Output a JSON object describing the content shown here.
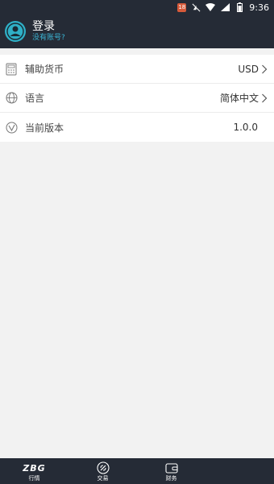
{
  "status_bar": {
    "time": "9:36",
    "notification_badge": "18"
  },
  "header": {
    "title": "登录",
    "subtitle": "没有账号?"
  },
  "settings": [
    {
      "icon": "calculator-icon",
      "label": "辅助货币",
      "value": "USD",
      "has_chevron": true
    },
    {
      "icon": "globe-icon",
      "label": "语言",
      "value": "简体中文",
      "has_chevron": true
    },
    {
      "icon": "version-check-icon",
      "label": "当前版本",
      "value": "1.0.0",
      "has_chevron": false
    }
  ],
  "tabbar": {
    "brand": "ZBG",
    "tabs": [
      {
        "label": "行情",
        "icon": "brand-logo"
      },
      {
        "label": "交易",
        "icon": "trade-icon"
      },
      {
        "label": "财务",
        "icon": "wallet-icon"
      },
      {
        "label": "",
        "icon": ""
      }
    ]
  },
  "colors": {
    "header_bg": "#252b36",
    "accent": "#3bb5d5",
    "avatar": "#2fb0c7"
  }
}
